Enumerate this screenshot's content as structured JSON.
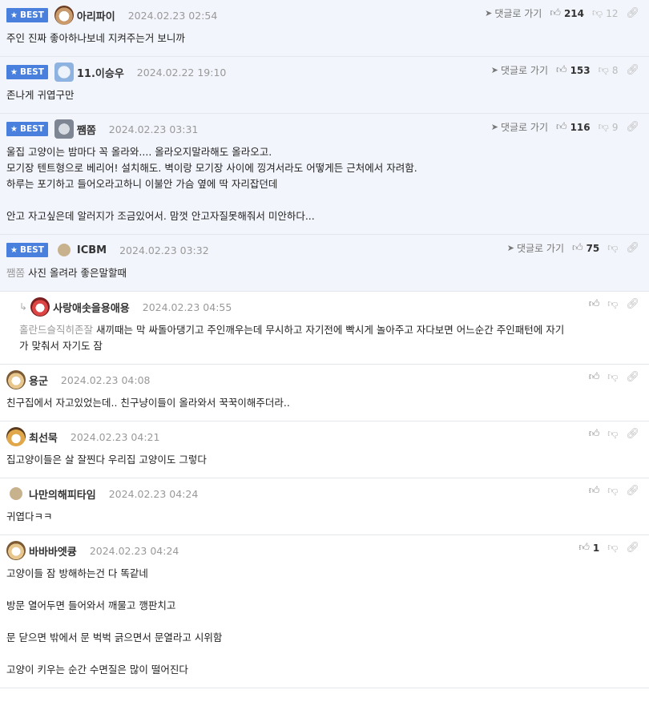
{
  "labels": {
    "best": "BEST",
    "go_reply": "댓글로 가기"
  },
  "comments": [
    {
      "best": true,
      "avatar": "dog1",
      "nick": "아리파이",
      "date": "2024.02.23 02:54",
      "up": "214",
      "down": "12",
      "lines": [
        "주인 진짜 좋아하나보네 지켜주는거 보니까"
      ]
    },
    {
      "best": true,
      "avatar": "dog2",
      "nick": "11.이승우",
      "date": "2024.02.22 19:10",
      "up": "153",
      "down": "8",
      "lines": [
        "존나게 귀엽구만"
      ]
    },
    {
      "best": true,
      "avatar": "koala",
      "nick": "쨈쫌",
      "date": "2024.02.23 03:31",
      "up": "116",
      "down": "9",
      "lines": [
        "울집 고양이는 밤마다 꼭 올라와.... 올라오지말라해도 올라오고.",
        "모기장 텐트형으로 베리어! 설치해도. 벽이랑 모기장 사이에 낑겨서라도 어떻게든 근처에서 자려함.",
        "하루는 포기하고 들어오라고하니 이불안 가슴 옆에 딱 자리잡던데",
        "",
        "안고 자고싶은데 알러지가 조금있어서. 맘껏 안고자질못해줘서 미안하다..."
      ]
    },
    {
      "best": true,
      "avatar": "dot",
      "nick": "ICBM",
      "date": "2024.02.23 03:32",
      "up": "75",
      "down": "",
      "mention": "쨈쫌",
      "lines": [
        "사진 올려라 좋은말할때"
      ]
    }
  ],
  "reply": {
    "avatar": "red",
    "nick": "사랑애솟을용애용",
    "date": "2024.02.23 04:55",
    "mention": "홀란드슬직히존잘",
    "lines": [
      "새끼때는 막 싸돌아댕기고 주인깨우는데 무시하고 자기전에 빡시게 놀아주고 자다보면 어느순간 주인패턴에 자기",
      "가 맞춰서 자기도 잠"
    ]
  },
  "normal": [
    {
      "avatar": "pup",
      "nick": "용군",
      "date": "2024.02.23 04:08",
      "up": "",
      "lines": [
        "친구집에서 자고있었는데.. 친구냥이들이 올라와서 꾹꾹이해주더라.."
      ]
    },
    {
      "avatar": "fox",
      "nick": "최선묵",
      "date": "2024.02.23 04:21",
      "up": "",
      "lines": [
        "집고양이들은 살 잘찐다 우리집 고양이도 그렇다"
      ]
    },
    {
      "avatar": "dot",
      "nick": "나만의해피타임",
      "date": "2024.02.23 04:24",
      "up": "",
      "lines": [
        "귀엽다ㅋㅋ"
      ]
    },
    {
      "avatar": "pup",
      "nick": "바바바엣큥",
      "date": "2024.02.23 04:24",
      "up": "1",
      "lines": [
        "고양이들 잠 방해하는건 다 똑같네",
        "",
        "방문 열어두면 들어와서 깨물고 깽판치고",
        "",
        "문 닫으면 밖에서 문 벅벅 긁으면서 문열라고 시위함",
        "",
        "고양이 키우는 순간 수면질은 많이 떨어진다"
      ]
    }
  ],
  "icons": {
    "plane": "send-icon",
    "thumbs_up": "thumbs-up-icon",
    "thumbs_down": "thumbs-down-icon",
    "link": "link-icon"
  }
}
